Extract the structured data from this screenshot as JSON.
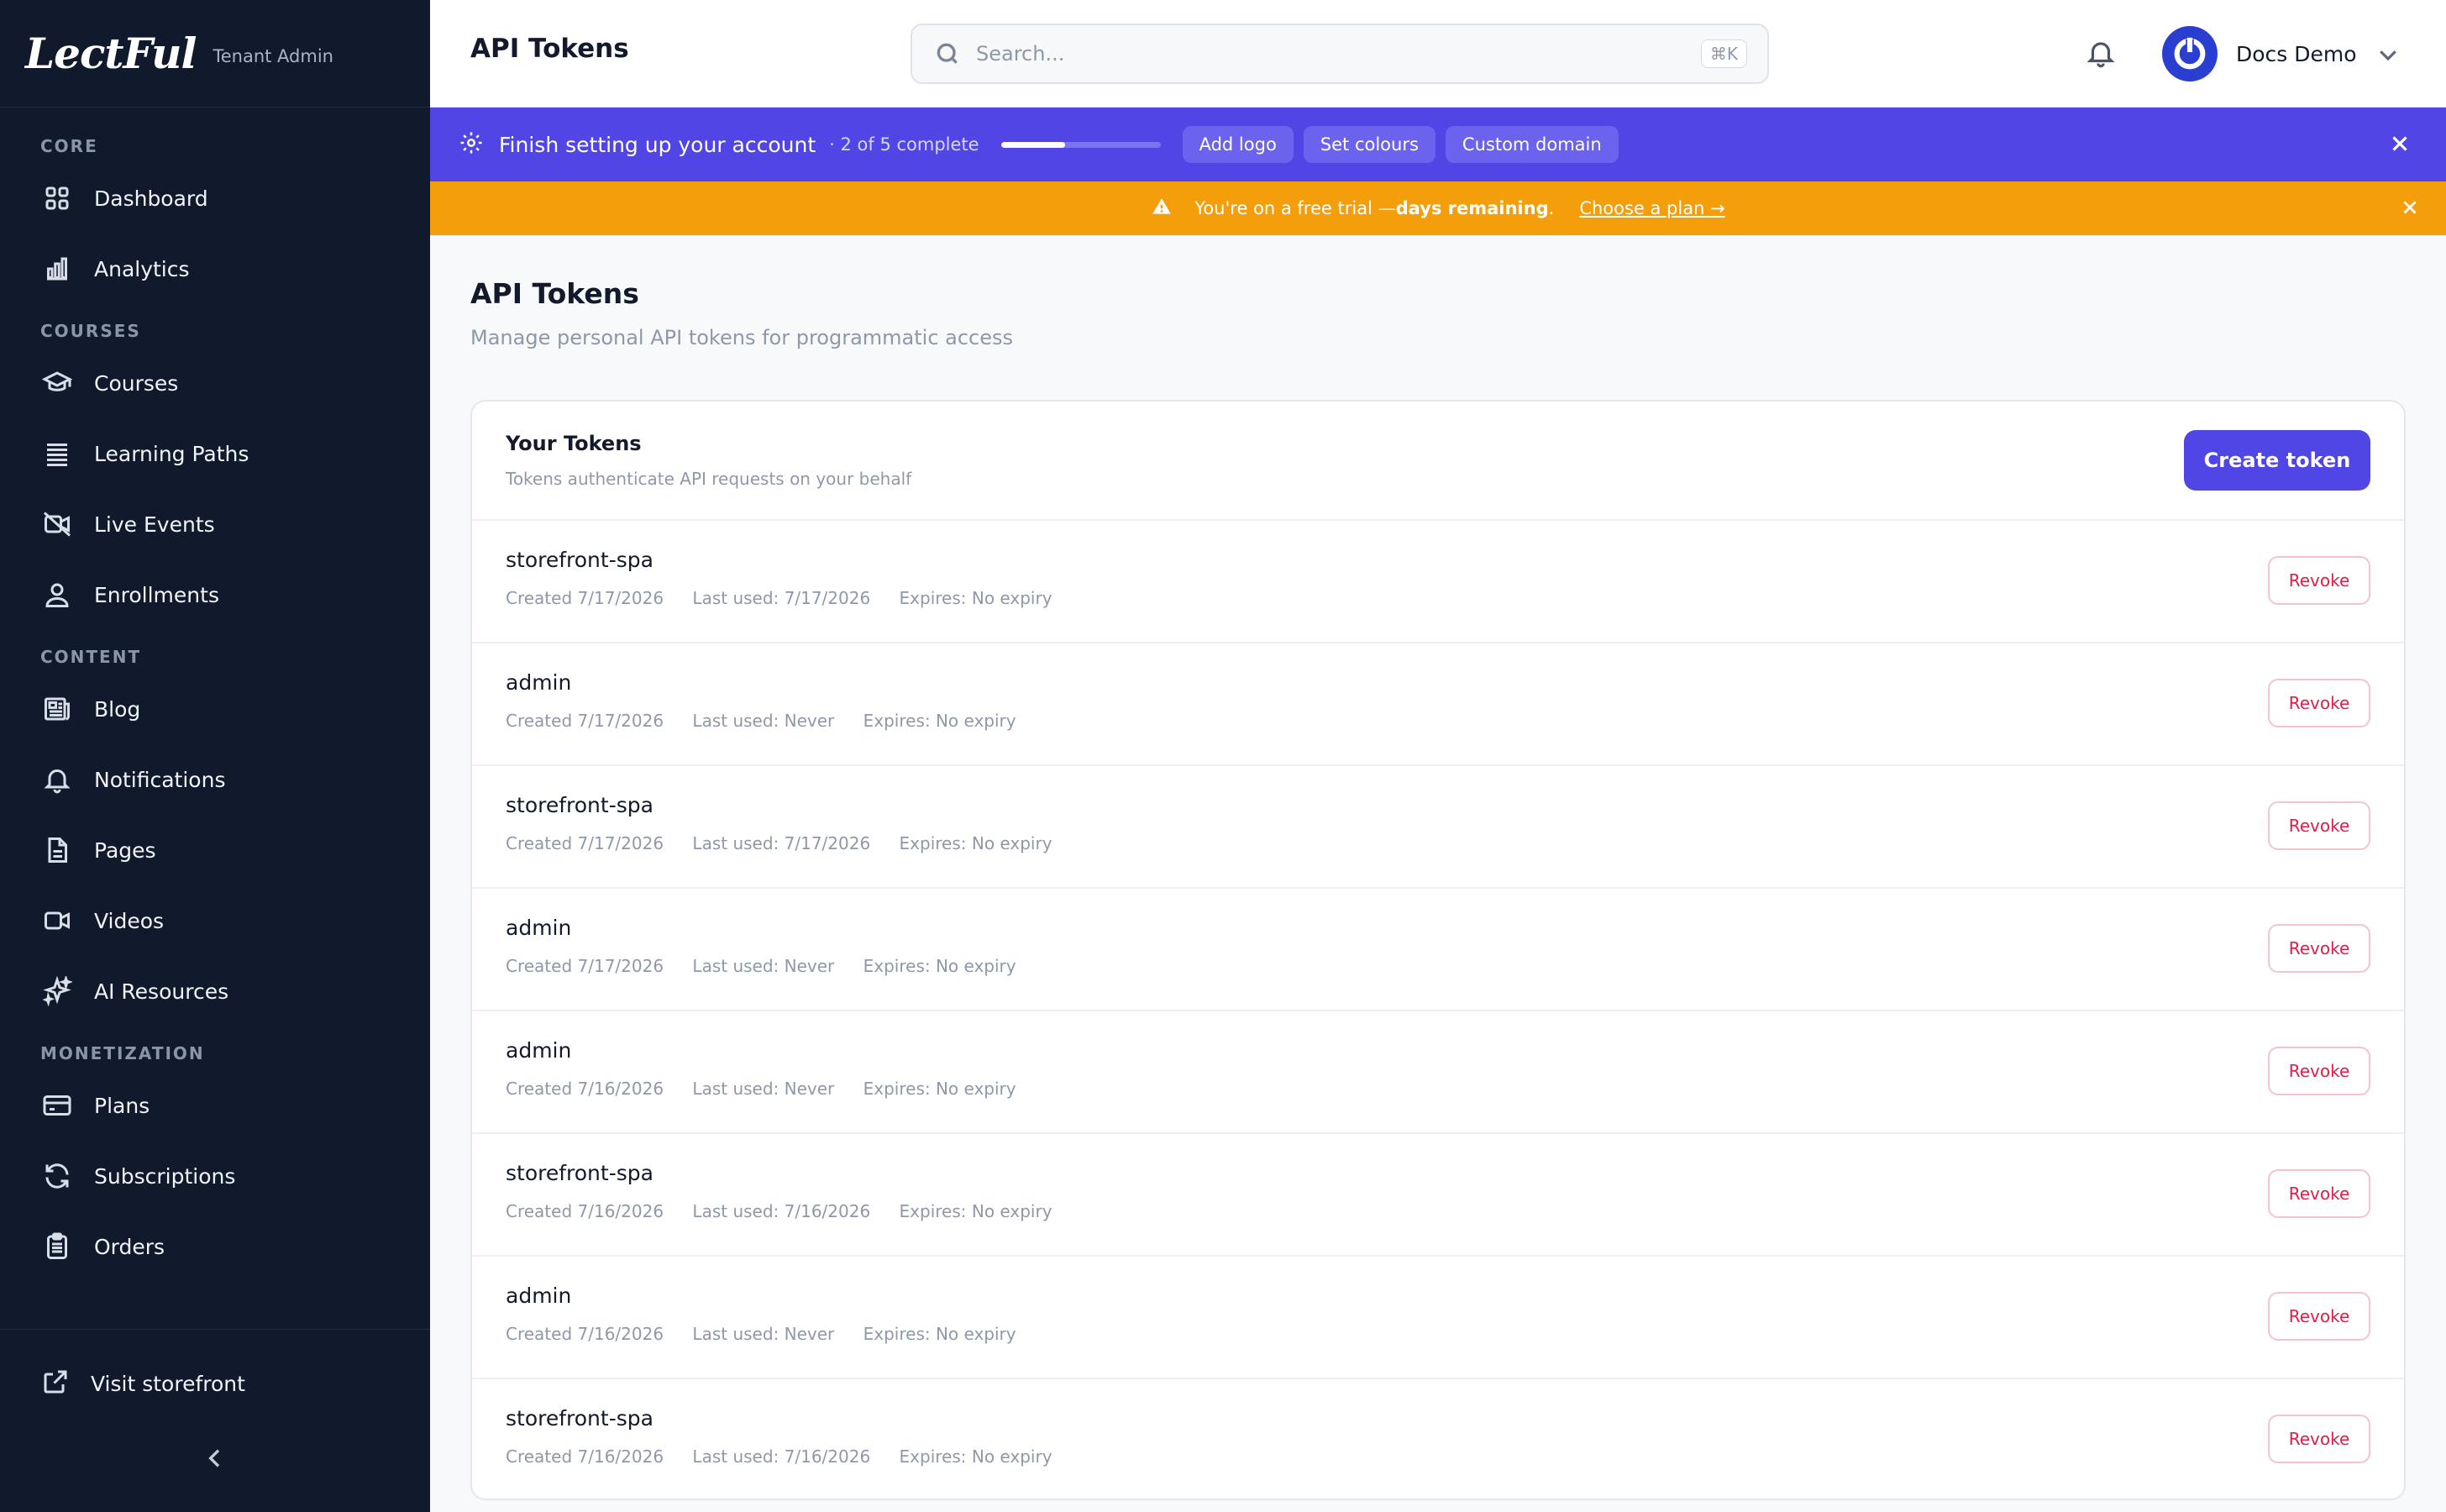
{
  "brand": {
    "logo": "LectFul",
    "subtitle": "Tenant Admin"
  },
  "sidebar": {
    "sections": [
      {
        "label": "CORE",
        "items": [
          {
            "label": "Dashboard",
            "icon": "grid-icon"
          },
          {
            "label": "Analytics",
            "icon": "bar-chart-icon"
          }
        ]
      },
      {
        "label": "COURSES",
        "items": [
          {
            "label": "Courses",
            "icon": "graduation-cap-icon"
          },
          {
            "label": "Learning Paths",
            "icon": "list-icon"
          },
          {
            "label": "Live Events",
            "icon": "video-off-icon"
          },
          {
            "label": "Enrollments",
            "icon": "user-icon"
          }
        ]
      },
      {
        "label": "CONTENT",
        "items": [
          {
            "label": "Blog",
            "icon": "newspaper-icon"
          },
          {
            "label": "Notifications",
            "icon": "bell-icon"
          },
          {
            "label": "Pages",
            "icon": "file-icon"
          },
          {
            "label": "Videos",
            "icon": "video-icon"
          },
          {
            "label": "AI Resources",
            "icon": "sparkles-icon"
          }
        ]
      },
      {
        "label": "MONETIZATION",
        "items": [
          {
            "label": "Plans",
            "icon": "credit-card-icon"
          },
          {
            "label": "Subscriptions",
            "icon": "refresh-icon"
          },
          {
            "label": "Orders",
            "icon": "clipboard-icon"
          }
        ]
      }
    ],
    "visit_label": "Visit storefront"
  },
  "topbar": {
    "title": "API Tokens",
    "search_placeholder": "Search...",
    "search_shortcut": "⌘K",
    "user_name": "Docs Demo"
  },
  "setup_banner": {
    "title": "Finish setting up your account",
    "progress_text": "· 2 of 5 complete",
    "progress_fraction": 0.4,
    "chips": [
      "Add logo",
      "Set colours",
      "Custom domain"
    ]
  },
  "trial_banner": {
    "text": "You're on a free trial — ",
    "bold": "days remaining",
    "dot": ".",
    "link": "Choose a plan →"
  },
  "page": {
    "heading": "API Tokens",
    "subheading": "Manage personal API tokens for programmatic access"
  },
  "tokens_card": {
    "title": "Your Tokens",
    "subtitle": "Tokens authenticate API requests on your behalf",
    "create_label": "Create token",
    "revoke_label": "Revoke",
    "tokens": [
      {
        "name": "storefront-spa",
        "created": "Created 7/17/2026",
        "last_used": "Last used: 7/17/2026",
        "expires": "Expires: No expiry"
      },
      {
        "name": "admin",
        "created": "Created 7/17/2026",
        "last_used": "Last used: Never",
        "expires": "Expires: No expiry"
      },
      {
        "name": "storefront-spa",
        "created": "Created 7/17/2026",
        "last_used": "Last used: 7/17/2026",
        "expires": "Expires: No expiry"
      },
      {
        "name": "admin",
        "created": "Created 7/17/2026",
        "last_used": "Last used: Never",
        "expires": "Expires: No expiry"
      },
      {
        "name": "admin",
        "created": "Created 7/16/2026",
        "last_used": "Last used: Never",
        "expires": "Expires: No expiry"
      },
      {
        "name": "storefront-spa",
        "created": "Created 7/16/2026",
        "last_used": "Last used: 7/16/2026",
        "expires": "Expires: No expiry"
      },
      {
        "name": "admin",
        "created": "Created 7/16/2026",
        "last_used": "Last used: Never",
        "expires": "Expires: No expiry"
      },
      {
        "name": "storefront-spa",
        "created": "Created 7/16/2026",
        "last_used": "Last used: 7/16/2026",
        "expires": "Expires: No expiry"
      }
    ]
  },
  "colors": {
    "sidebar_bg": "#111a2c",
    "accent": "#4f46e5",
    "setup_banner_bg": "#5146e5",
    "trial_banner_bg": "#f59e0b",
    "revoke_text": "#e11d48"
  }
}
